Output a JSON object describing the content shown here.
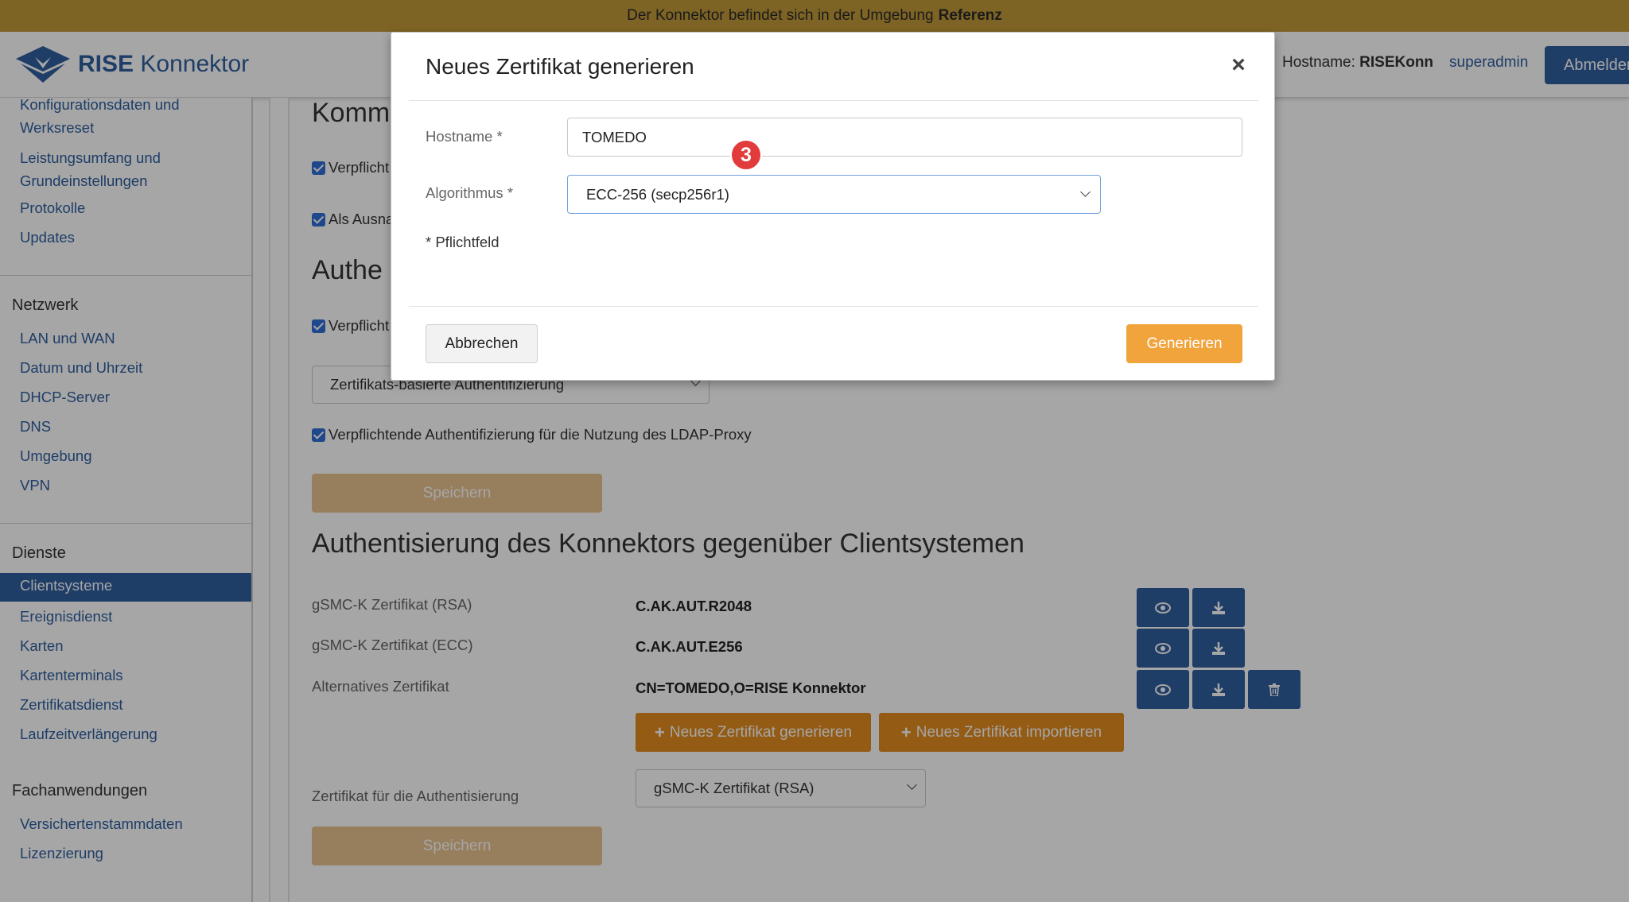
{
  "banner": {
    "text": "Der Konnektor befindet sich in der Umgebung",
    "env": "Referenz"
  },
  "header": {
    "logo_bold": "RISE",
    "logo_rest": "Konnektor",
    "hostname_label": "Hostname:",
    "hostname_value": "RISEKonn",
    "user": "superadmin",
    "logout": "Abmelden"
  },
  "sidebar": {
    "top_items": [
      "Konfigurationsdaten und",
      "Werksreset",
      "Leistungsumfang und",
      "Grundeinstellungen",
      "Protokolle",
      "Updates"
    ],
    "netzwerk": {
      "title": "Netzwerk",
      "items": [
        "LAN und WAN",
        "Datum und Uhrzeit",
        "DHCP-Server",
        "DNS",
        "Umgebung",
        "VPN"
      ]
    },
    "dienste": {
      "title": "Dienste",
      "active": "Clientsysteme",
      "items": [
        "Ereignisdienst",
        "Karten",
        "Kartenterminals",
        "Zertifikatsdienst",
        "Laufzeitverlängerung"
      ]
    },
    "fachanwendungen": {
      "title": "Fachanwendungen",
      "items": [
        "Versichertenstammdaten",
        "Lizenzierung"
      ]
    }
  },
  "main": {
    "heading_partial_1": "Komm",
    "checkbox_1": "Verpflicht",
    "checkbox_2": "Als Ausna",
    "heading_partial_2": "Authe",
    "checkbox_3": "Verpflicht",
    "auth_select": "Zertifikats-basierte Authentifizierung",
    "ldap_checkbox": "Verpflichtende Authentifizierung für die Nutzung des LDAP-Proxy",
    "save_1": "Speichern",
    "section_title": "Authentisierung des Konnektors gegenüber Clientsystemen",
    "certs": [
      {
        "label": "gSMC-K Zertifikat (RSA)",
        "value": "C.AK.AUT.R2048"
      },
      {
        "label": "gSMC-K Zertifikat (ECC)",
        "value": "C.AK.AUT.E256"
      },
      {
        "label": "Alternatives Zertifikat",
        "value": "CN=TOMEDO,O=RISE Konnektor"
      }
    ],
    "new_cert_btn": "Neues Zertifikat generieren",
    "import_cert_btn": "Neues Zertifikat importieren",
    "auth_cert_label": "Zertifikat für die Authentisierung",
    "auth_cert_select": "gSMC-K Zertifikat (RSA)",
    "save_2": "Speichern"
  },
  "modal": {
    "title": "Neues Zertifikat generieren",
    "close": "×",
    "hostname_label": "Hostname *",
    "hostname_value": "TOMEDO",
    "algo_label": "Algorithmus *",
    "algo_value": "ECC-256 (secp256r1)",
    "required_note": "* Pflichtfeld",
    "cancel": "Abbrechen",
    "generate": "Generieren",
    "step_badge": "3"
  },
  "colors": {
    "banner": "#c29a38",
    "brand_blue": "#2e5e9e",
    "orange": "#e28d1f",
    "badge_red": "#e23b3b"
  }
}
